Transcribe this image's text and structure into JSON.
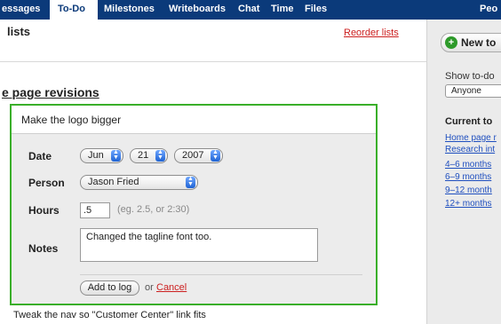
{
  "nav": {
    "tabs": [
      {
        "label": "essages",
        "active": false
      },
      {
        "label": "To-Do",
        "active": true
      },
      {
        "label": "Milestones",
        "active": false
      },
      {
        "label": "Writeboards",
        "active": false
      },
      {
        "label": "Chat",
        "active": false
      },
      {
        "label": "Time",
        "active": false
      },
      {
        "label": "Files",
        "active": false
      },
      {
        "label": "Peo",
        "active": false
      }
    ]
  },
  "main": {
    "title": "lists",
    "reorder_label": "Reorder lists",
    "list_title": "e page revisions",
    "form": {
      "item_text": "Make the logo bigger",
      "date_label": "Date",
      "date_month": "Jun",
      "date_day": "21",
      "date_year": "2007",
      "person_label": "Person",
      "person_value": "Jason Fried",
      "hours_label": "Hours",
      "hours_value": ".5",
      "hours_hint": "(eg. 2.5, or 2:30)",
      "notes_label": "Notes",
      "notes_value": "Changed the tagline font too.",
      "add_button": "Add to log",
      "or_text": "or",
      "cancel_label": "Cancel"
    },
    "next_item": "Tweak the nav so \"Customer Center\" link fits"
  },
  "sidebar": {
    "new_todo_label": "New to",
    "show_label": "Show to-do",
    "filter_value": "Anyone",
    "current_title": "Current to",
    "current_links": [
      "Home page r",
      "Research int",
      "4–6 months",
      "6–9 months",
      "9–12 month",
      "12+ months"
    ]
  },
  "colors": {
    "nav_bg": "#0b3a7a",
    "accent_green": "#3aaf2a",
    "link_red": "#cc1f1f",
    "link_blue": "#1f4fbf"
  }
}
